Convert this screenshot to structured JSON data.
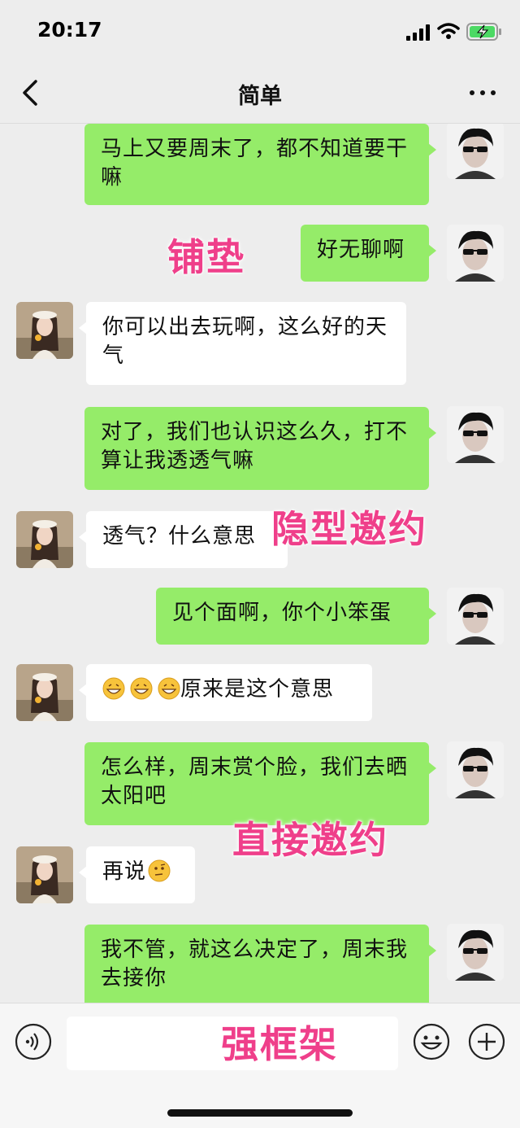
{
  "status": {
    "time": "20:17"
  },
  "nav": {
    "title": "简单"
  },
  "messages": [
    {
      "from": "me",
      "text": "马上又要周末了，都不知道要干嘛"
    },
    {
      "from": "me",
      "text": "好无聊啊"
    },
    {
      "from": "other",
      "text": "你可以出去玩啊，这么好的天气"
    },
    {
      "from": "me",
      "text": "对了，我们也认识这么久，打不算让我透透气嘛"
    },
    {
      "from": "other",
      "text": "透气？什么意思"
    },
    {
      "from": "me",
      "text": "见个面啊，你个小笨蛋"
    },
    {
      "from": "other",
      "text": "原来是这个意思",
      "emojis": [
        "grin-emoji",
        "grin-emoji",
        "grin-emoji"
      ]
    },
    {
      "from": "me",
      "text": "怎么样，周末赏个脸，我们去晒太阳吧"
    },
    {
      "from": "other",
      "text": "再说",
      "emojis_after": [
        "thinking-emoji"
      ]
    },
    {
      "from": "me",
      "text": "我不管，就这么决定了，周末我去接你"
    }
  ],
  "annotations": [
    "铺垫",
    "隐型邀约",
    "直接邀约",
    "强框架"
  ],
  "colors": {
    "me_bubble": "#95ec69",
    "other_bubble": "#ffffff",
    "annotation": "#ef3f8a",
    "background": "#ededed"
  },
  "icons": [
    "signal-icon",
    "wifi-icon",
    "battery-charging-icon",
    "back-icon",
    "more-icon",
    "voice-icon",
    "emoji-icon",
    "plus-icon"
  ]
}
